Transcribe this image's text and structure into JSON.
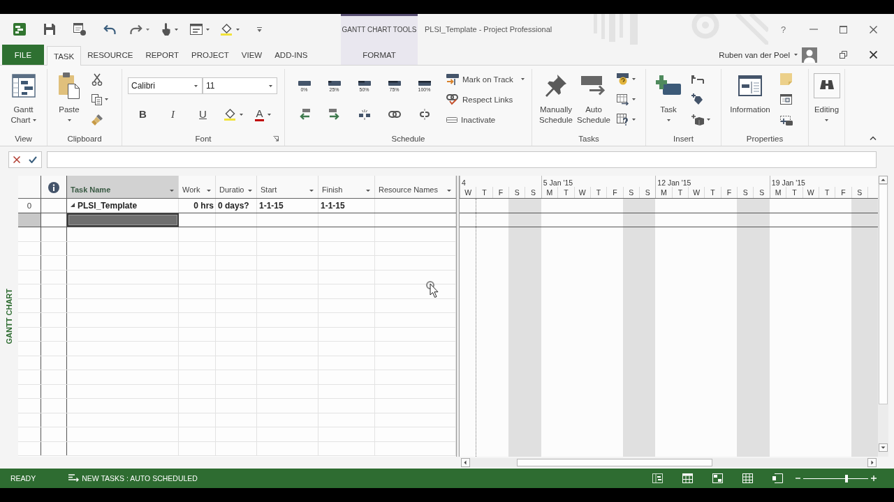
{
  "title_bar": {
    "context_label": "GANTT CHART TOOLS",
    "title": "PLSI_Template - Project Professional",
    "help": "?"
  },
  "tabs": [
    {
      "label": "FILE",
      "kind": "backstage",
      "selected": false
    },
    {
      "label": "TASK",
      "kind": "tab",
      "selected": true
    },
    {
      "label": "RESOURCE",
      "kind": "tab",
      "selected": false
    },
    {
      "label": "REPORT",
      "kind": "tab",
      "selected": false
    },
    {
      "label": "PROJECT",
      "kind": "tab",
      "selected": false
    },
    {
      "label": "VIEW",
      "kind": "tab",
      "selected": false
    },
    {
      "label": "ADD-INS",
      "kind": "tab",
      "selected": false
    },
    {
      "label": "FORMAT",
      "kind": "contextual",
      "selected": false
    }
  ],
  "account": {
    "name": "Ruben van der Poel"
  },
  "ribbon": [
    {
      "kind": "view",
      "label": "View",
      "buttons": [
        {
          "label": "Gantt Chart",
          "dropdown": true
        }
      ]
    },
    {
      "kind": "clipboard",
      "label": "Clipboard",
      "buttons": [
        {
          "label": "Paste",
          "dropdown": true
        }
      ]
    },
    {
      "kind": "font",
      "label": "Font",
      "font_name": "Calibri",
      "font_size": "11",
      "styles": [
        "B",
        "I",
        "U"
      ],
      "font_color": "A"
    },
    {
      "kind": "schedule",
      "label": "Schedule",
      "percent_buttons": [
        "0%",
        "25%",
        "50%",
        "75%",
        "100%"
      ],
      "commands": [
        {
          "label": "Mark on Track",
          "dropdown": true
        },
        {
          "label": "Respect Links",
          "dropdown": false
        },
        {
          "label": "Inactivate",
          "dropdown": false
        }
      ]
    },
    {
      "kind": "tasks",
      "label": "Tasks",
      "buttons": [
        {
          "label": "Manually Schedule",
          "dropdown": false
        },
        {
          "label": "Auto Schedule",
          "dropdown": false
        }
      ]
    },
    {
      "kind": "insert",
      "label": "Insert",
      "buttons": [
        {
          "label": "Task",
          "dropdown": true
        }
      ]
    },
    {
      "kind": "properties",
      "label": "Properties",
      "buttons": [
        {
          "label": "Information",
          "dropdown": false
        }
      ]
    },
    {
      "kind": "editing",
      "buttons": [
        {
          "label": "Editing",
          "dropdown": true
        }
      ]
    }
  ],
  "side_label": "GANTT CHART",
  "table": {
    "columns": [
      {
        "label": "Task Name",
        "selected": true
      },
      {
        "label": "Work",
        "selected": false
      },
      {
        "label": "Duratio",
        "selected": false
      },
      {
        "label": "Start",
        "selected": false
      },
      {
        "label": "Finish",
        "selected": false
      },
      {
        "label": "Resource Names",
        "selected": false
      }
    ],
    "rows": [
      {
        "id": "0",
        "task_name": "PLSI_Template",
        "work": "0 hrs",
        "duration": "0 days?",
        "start": "1-1-15",
        "finish": "1-1-15",
        "summary": true,
        "expanded": true,
        "selected": false
      },
      {
        "selected": true
      }
    ]
  },
  "timescale": {
    "weeks": [
      {
        "label": "4",
        "days": [
          {
            "label": "W",
            "weekend": false
          },
          {
            "label": "T",
            "weekend": false
          },
          {
            "label": "F",
            "weekend": false
          },
          {
            "label": "S",
            "weekend": true
          },
          {
            "label": "S",
            "weekend": true
          }
        ]
      },
      {
        "label": "5 Jan '15",
        "days": [
          {
            "label": "M",
            "weekend": false
          },
          {
            "label": "T",
            "weekend": false
          },
          {
            "label": "W",
            "weekend": false
          },
          {
            "label": "T",
            "weekend": false
          },
          {
            "label": "F",
            "weekend": false
          },
          {
            "label": "S",
            "weekend": true
          },
          {
            "label": "S",
            "weekend": true
          }
        ]
      },
      {
        "label": "12 Jan '15",
        "days": [
          {
            "label": "M",
            "weekend": false
          },
          {
            "label": "T",
            "weekend": false
          },
          {
            "label": "W",
            "weekend": false
          },
          {
            "label": "T",
            "weekend": false
          },
          {
            "label": "F",
            "weekend": false
          },
          {
            "label": "S",
            "weekend": true
          },
          {
            "label": "S",
            "weekend": true
          }
        ]
      },
      {
        "label": "19 Jan '15",
        "days": [
          {
            "label": "M",
            "weekend": false
          },
          {
            "label": "T",
            "weekend": false
          },
          {
            "label": "W",
            "weekend": false
          },
          {
            "label": "T",
            "weekend": false
          },
          {
            "label": "F",
            "weekend": false
          },
          {
            "label": "S",
            "weekend": true
          },
          {
            "weekend": true
          }
        ]
      }
    ]
  },
  "status_bar": {
    "mode": "READY",
    "new_tasks": "NEW TASKS : AUTO SCHEDULED",
    "zoom": {
      "level": 0.67
    }
  }
}
